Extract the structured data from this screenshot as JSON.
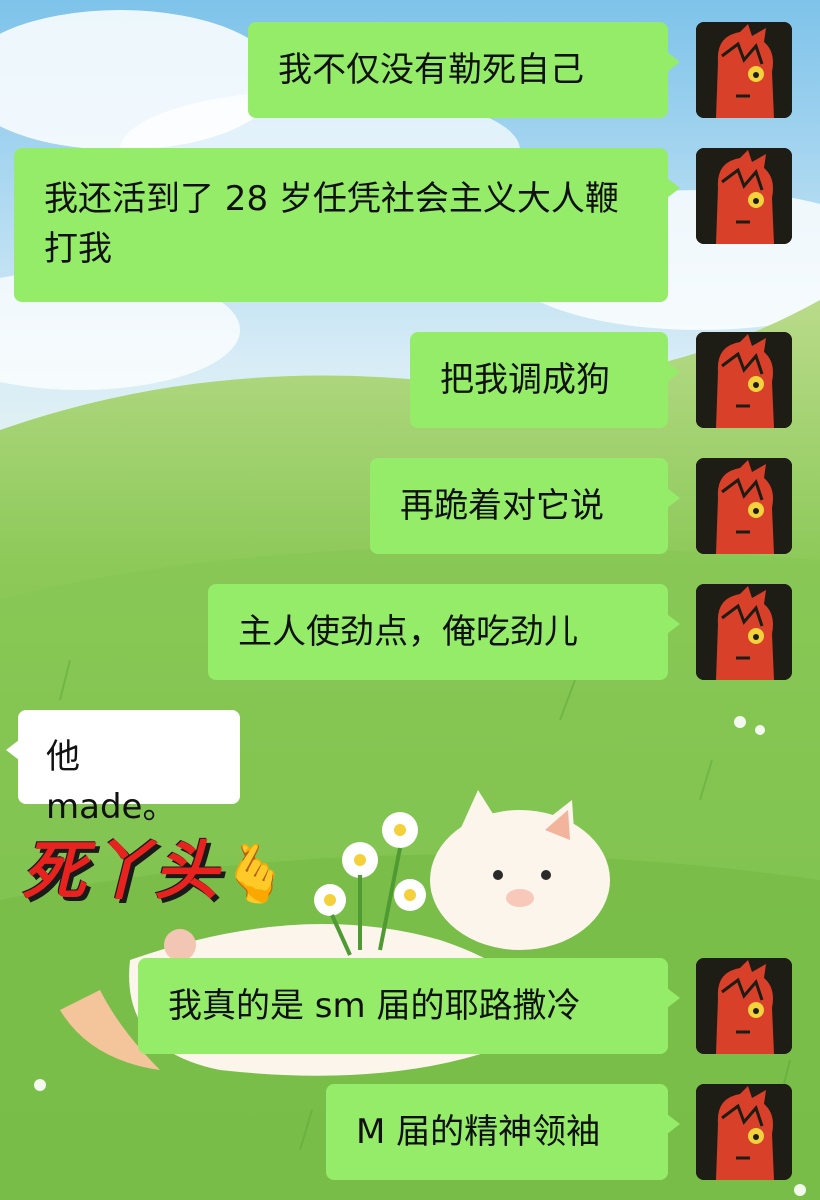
{
  "messages": [
    {
      "side": "out",
      "text": "我不仅没有勒死自己"
    },
    {
      "side": "out",
      "text": "我还活到了 28 岁任凭社会主义大人鞭打我"
    },
    {
      "side": "out",
      "text": "把我调成狗"
    },
    {
      "side": "out",
      "text": "再跪着对它说"
    },
    {
      "side": "out",
      "text": "主人使劲点，俺吃劲儿"
    },
    {
      "side": "in",
      "text": "他 made。"
    },
    {
      "side": "out",
      "text": "我真的是 sm 届的耶路撒冷"
    },
    {
      "side": "out",
      "text": "M 届的精神领袖"
    }
  ],
  "sticker": {
    "text": "死丫头",
    "hand": "🫰"
  },
  "colors": {
    "outgoing_bubble": "#95ec69",
    "incoming_bubble": "#ffffff",
    "sticker_text": "#e8231f"
  },
  "icons": {
    "avatar": "red-creature-avatar-icon"
  }
}
